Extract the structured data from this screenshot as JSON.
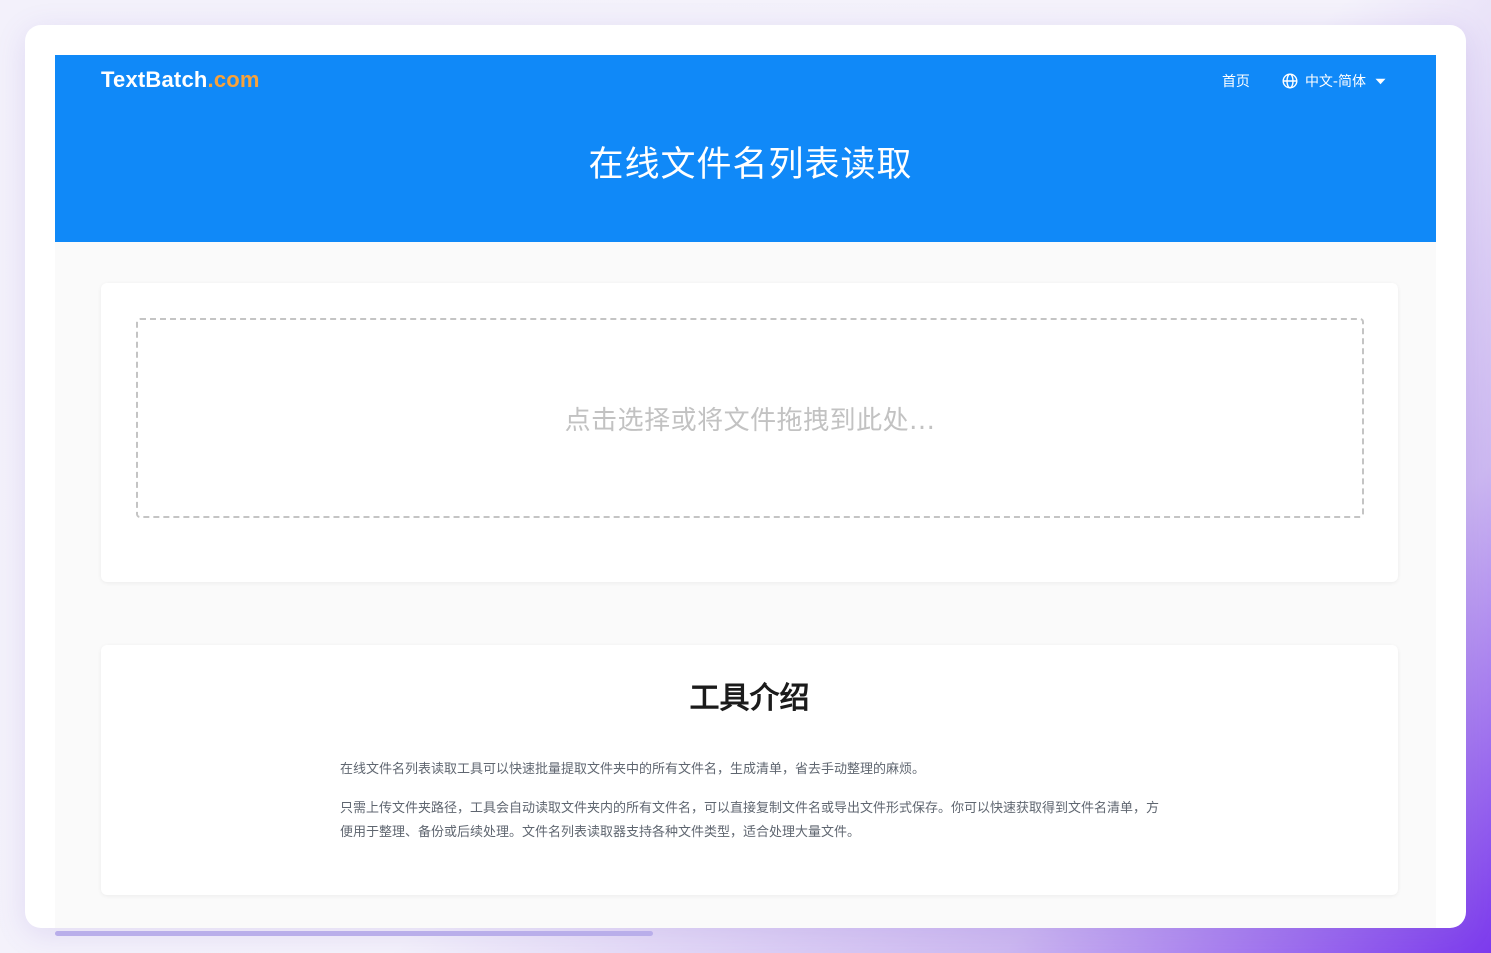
{
  "header": {
    "logo_main": "TextBatch",
    "logo_accent": ".com",
    "nav_home": "首页",
    "language": "中文-简体",
    "title": "在线文件名列表读取"
  },
  "upload": {
    "dropzone_text": "点击选择或将文件拖拽到此处..."
  },
  "intro": {
    "title": "工具介绍",
    "paragraphs": [
      "在线文件名列表读取工具可以快速批量提取文件夹中的所有文件名，生成清单，省去手动整理的麻烦。",
      "只需上传文件夹路径，工具会自动读取文件夹内的所有文件名，可以直接复制文件名或导出文件形式保存。你可以快速获取得到文件名清单，方便用于整理、备份或后续处理。文件名列表读取器支持各种文件类型，适合处理大量文件。"
    ]
  },
  "colors": {
    "header_bg": "#1089f8",
    "logo_accent": "#f7a23b",
    "dropzone_border": "#c4c4c4"
  },
  "icons": {
    "language": "globe-icon",
    "dropdown": "caret-down-icon"
  }
}
